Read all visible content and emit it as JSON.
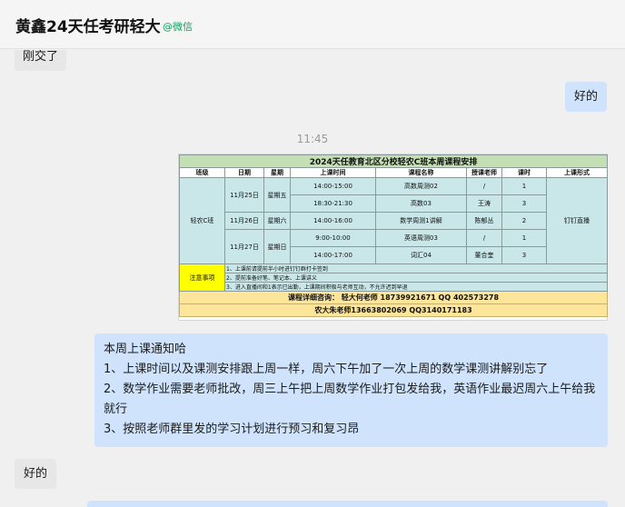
{
  "header": {
    "title": "黄鑫24天任考研轻大",
    "source": "@微信"
  },
  "messages": {
    "m1": "刚交了",
    "m2": "好的",
    "time": "11:45",
    "m3": {
      "lines": [
        "本周上课通知哈",
        "1、上课时间以及课测安排跟上周一样，周六下午加了一次上周的数学课测讲解别忘了",
        " 2、数学作业需要老师批改，周三上午把上周数学作业打包发给我，英语作业最迟周六上午给我就行",
        "3、按照老师群里发的学习计划进行预习和复习昂"
      ]
    },
    "m4": "好的"
  },
  "schedule": {
    "title": "2024天任教育北区分校轻农C班本周课程安排",
    "headers": [
      "班级",
      "日期",
      "星期",
      "上课时间",
      "课程名称",
      "授课老师",
      "课时",
      "上课形式"
    ],
    "class_name": "轻农C班",
    "mode": "钉钉直播",
    "days": [
      {
        "date": "11月25日",
        "weekday": "星期五"
      },
      {
        "date": "11月26日",
        "weekday": "星期六"
      },
      {
        "date": "11月27日",
        "weekday": "星期日"
      }
    ],
    "rows": [
      {
        "time": "14:00-15:00",
        "course": "高数周测02",
        "teacher": "/",
        "hours": "1"
      },
      {
        "time": "18:30-21:30",
        "course": "高数03",
        "teacher": "王涛",
        "hours": "3"
      },
      {
        "time": "14:00-16:00",
        "course": "数学周测1讲解",
        "teacher": "陈郁丛",
        "hours": "2"
      },
      {
        "time": "9:00-10:00",
        "course": "英语周测03",
        "teacher": "/",
        "hours": "1"
      },
      {
        "time": "14:00-17:00",
        "course": "词汇04",
        "teacher": "董合奎",
        "hours": "3"
      }
    ],
    "note_label": "注意事项",
    "notes": [
      "1、上课前请提前半小时进钉钉群打卡签到",
      "2、提前准备好笔、笔记本、上课讲义",
      "3、进入直播间和1表示已出勤，上课期间积极与老师互动，不允许迟到早退"
    ],
    "contact_1": "课程详细咨询：  轻大何老师 18739921671   QQ 402573278",
    "contact_2": "农大朱老师13663802069      QQ3140171183"
  }
}
